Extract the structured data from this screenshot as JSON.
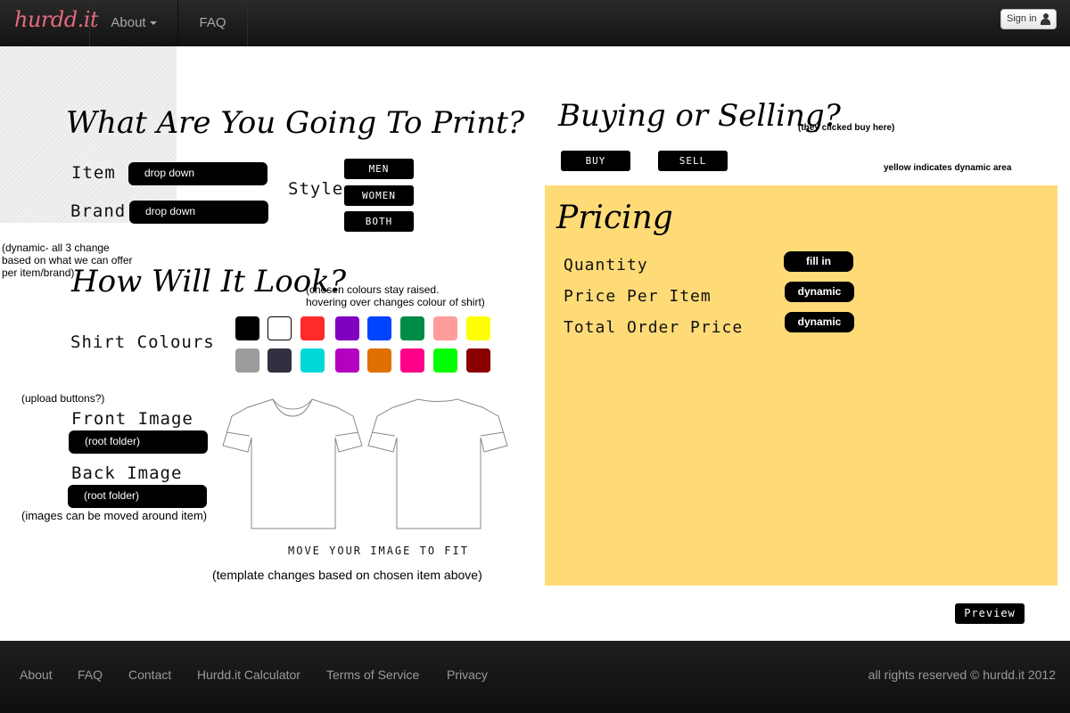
{
  "navbar": {
    "brand": "hurdd.it",
    "about": "About",
    "faq": "FAQ",
    "signin": "Sign in"
  },
  "print_section": {
    "title": "What Are You Going To Print?",
    "item_label": "Item",
    "item_value": "drop down",
    "brand_label": "Brand",
    "brand_value": "drop down",
    "style_label": "Style",
    "style_options": [
      "MEN",
      "WOMEN",
      "BOTH"
    ],
    "dynamic_note": [
      "(dynamic- all 3 change",
      "based on what we can offer",
      "per item/brand)"
    ]
  },
  "look_section": {
    "title": "How Will It Look?",
    "colour_note": [
      "(chosen colours stay raised.",
      "hovering over changes colour of shirt)"
    ],
    "shirt_colours_label": "Shirt Colours",
    "colours_row1": [
      "#000000",
      "#ffffff",
      "#ff2a2a",
      "#8000c0",
      "#0044ff",
      "#008c44",
      "#ff9c9c",
      "#ffff00"
    ],
    "colours_row2": [
      "#9c9c9c",
      "#303040",
      "#00d8d8",
      "#b400c0",
      "#e07000",
      "#ff0088",
      "#00ff00",
      "#8a0000"
    ],
    "upload_note": "(upload buttons?)",
    "front_label": "Front Image",
    "front_value": "(root folder)",
    "back_label": "Back Image",
    "back_value": "(root folder)",
    "images_note": "(images can be moved around item)",
    "move_caption": "MOVE YOUR IMAGE TO FIT",
    "template_note": "(template changes based on chosen item above)"
  },
  "buying_section": {
    "title": "Buying or Selling?",
    "note": "(they clicked buy here)",
    "buy": "BUY",
    "sell": "SELL",
    "yellow_note": "yellow indicates dynamic area"
  },
  "pricing": {
    "title": "Pricing",
    "quantity_label": "Quantity",
    "quantity_value": "fill in",
    "price_label": "Price Per Item",
    "price_value": "dynamic",
    "total_label": "Total Order Price",
    "total_value": "dynamic",
    "panel_color": "#ffdb78"
  },
  "preview": "Preview",
  "footer": {
    "links": [
      "About",
      "FAQ",
      "Contact",
      "Hurdd.it Calculator",
      "Terms of Service",
      "Privacy"
    ],
    "copyright": "all rights reserved © hurdd.it 2012"
  }
}
